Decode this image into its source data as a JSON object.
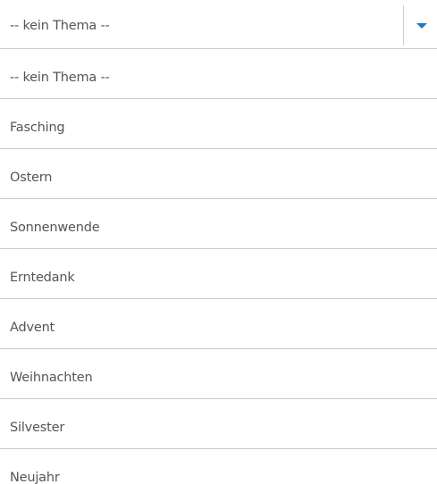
{
  "select": {
    "selected_value": "-- kein Thema --",
    "toggle_icon": "caret-down-icon",
    "accent_color": "#1e78bd"
  },
  "options": [
    "-- kein Thema --",
    "Fasching",
    "Ostern",
    "Sonnenwende",
    "Erntedank",
    "Advent",
    "Weihnachten",
    "Silvester",
    "Neujahr"
  ]
}
